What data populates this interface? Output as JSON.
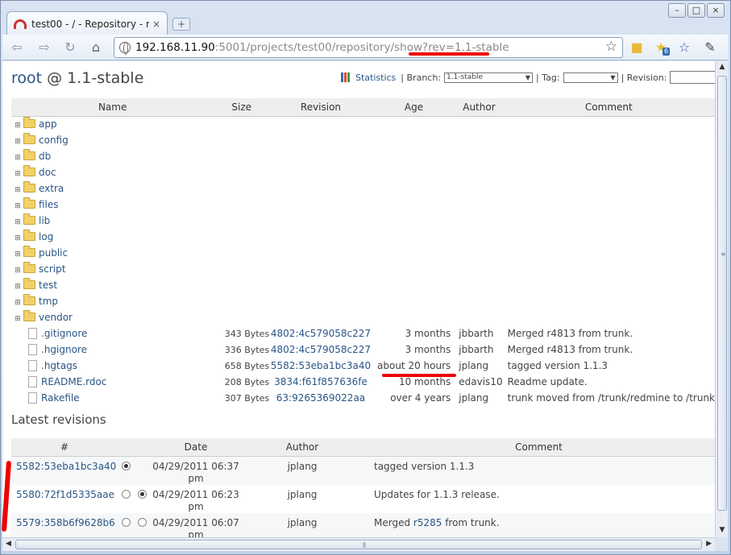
{
  "browser": {
    "tab_title": "test00 - / - Repository - r...",
    "tab_close": "×",
    "new_tab": "+",
    "window_min": "–",
    "window_max": "□",
    "window_close": "×",
    "url_host": "192.168.11.90",
    "url_path": ":5001/projects/test00/repository/show?rev=1.1-stable",
    "extension_badge": "6",
    "icons": [
      "back-icon",
      "forward-icon",
      "reload-icon",
      "home-icon",
      "globe-icon",
      "star-icon",
      "folder-icon",
      "extension-icon",
      "bookmark-star-icon",
      "wrench-icon"
    ]
  },
  "header": {
    "root_link": "root",
    "title_rest": " @ 1.1-stable",
    "statistics": "Statistics",
    "separator": "|",
    "branch_label": "Branch:",
    "branch_value": "1.1-stable",
    "tag_label": "Tag:",
    "tag_value": "",
    "revision_label": "Revision:"
  },
  "files_table": {
    "columns": [
      "Name",
      "Size",
      "Revision",
      "Age",
      "Author",
      "Comment"
    ],
    "folders": [
      "app",
      "config",
      "db",
      "doc",
      "extra",
      "files",
      "lib",
      "log",
      "public",
      "script",
      "test",
      "tmp",
      "vendor"
    ],
    "files": [
      {
        "name": ".gitignore",
        "size": "343 Bytes",
        "revision": "4802:4c579058c227",
        "age": "3 months",
        "author": "jbbarth",
        "comment": "Merged r4813 from trunk."
      },
      {
        "name": ".hgignore",
        "size": "336 Bytes",
        "revision": "4802:4c579058c227",
        "age": "3 months",
        "author": "jbbarth",
        "comment": "Merged r4813 from trunk."
      },
      {
        "name": ".hgtags",
        "size": "658 Bytes",
        "revision": "5582:53eba1bc3a40",
        "age": "about 20 hours",
        "author": "jplang",
        "comment": "tagged version 1.1.3"
      },
      {
        "name": "README.rdoc",
        "size": "208 Bytes",
        "revision": "3834:f61f857636fe",
        "age": "10 months",
        "author": "edavis10",
        "comment": "Readme update."
      },
      {
        "name": "Rakefile",
        "size": "307 Bytes",
        "revision": "63:9265369022aa",
        "age": "over 4 years",
        "author": "jplang",
        "comment": "trunk moved from /trunk/redmine to /trunk"
      }
    ]
  },
  "latest": {
    "heading": "Latest revisions",
    "columns": [
      "#",
      "",
      "",
      "Date",
      "Author",
      "Comment"
    ],
    "rows": [
      {
        "rev": "5582:53eba1bc3a40",
        "date": "04/29/2011 06:37",
        "date2": "pm",
        "author": "jplang",
        "comment": "tagged version 1.1.3",
        "comment_link": "",
        "comment_after": ""
      },
      {
        "rev": "5580:72f1d5335aae",
        "date": "04/29/2011 06:23",
        "date2": "pm",
        "author": "jplang",
        "comment": "Updates for 1.1.3 release.",
        "comment_link": "",
        "comment_after": ""
      },
      {
        "rev": "5579:358b6f9628b6",
        "date": "04/29/2011 06:07",
        "date2": "pm",
        "author": "jplang",
        "comment": "Merged ",
        "comment_link": "r5285",
        "comment_after": " from trunk."
      }
    ]
  },
  "colors": {
    "link": "#2a5685",
    "annotation": "#e00000",
    "folder": "#f2d16b"
  }
}
